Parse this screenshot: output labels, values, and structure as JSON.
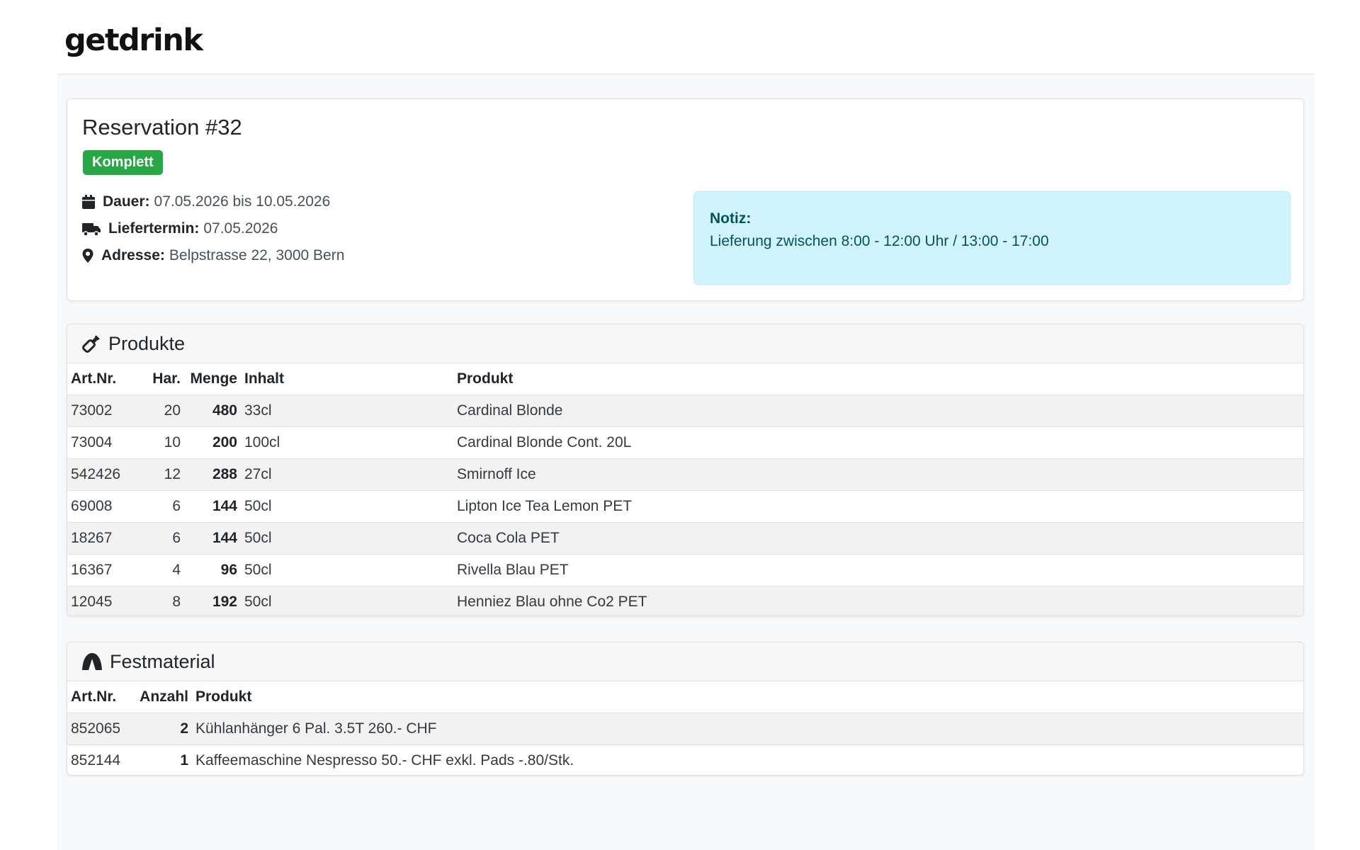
{
  "brand": {
    "logo_text": "getdrink"
  },
  "reservation": {
    "title": "Reservation #32",
    "status_badge": "Komplett",
    "status_color": "#28a745",
    "dauer_label": "Dauer:",
    "dauer_value": "07.05.2026 bis 10.05.2026",
    "liefertermin_label": "Liefertermin:",
    "liefertermin_value": "07.05.2026",
    "adresse_label": "Adresse:",
    "adresse_value": "Belpstrasse 22, 3000 Bern",
    "icons": {
      "dauer": "calendar-icon",
      "liefertermin": "truck-icon",
      "adresse": "map-marker-icon"
    }
  },
  "note": {
    "title": "Notiz:",
    "text": "Lieferung zwischen 8:00 - 12:00 Uhr / 13:00 - 17:00",
    "background_color": "#cff4fc"
  },
  "products": {
    "header": "Produkte",
    "icon": "bottle-icon",
    "columns": [
      "Art.Nr.",
      "Har.",
      "Menge",
      "Inhalt",
      "Produkt"
    ],
    "rows": [
      {
        "artnr": "73002",
        "har": "20",
        "menge": "480",
        "inhalt": "33cl",
        "produkt": "Cardinal Blonde"
      },
      {
        "artnr": "73004",
        "har": "10",
        "menge": "200",
        "inhalt": "100cl",
        "produkt": "Cardinal Blonde Cont. 20L"
      },
      {
        "artnr": "542426",
        "har": "12",
        "menge": "288",
        "inhalt": "27cl",
        "produkt": "Smirnoff Ice"
      },
      {
        "artnr": "69008",
        "har": "6",
        "menge": "144",
        "inhalt": "50cl",
        "produkt": "Lipton Ice Tea Lemon PET"
      },
      {
        "artnr": "18267",
        "har": "6",
        "menge": "144",
        "inhalt": "50cl",
        "produkt": "Coca Cola PET"
      },
      {
        "artnr": "16367",
        "har": "4",
        "menge": "96",
        "inhalt": "50cl",
        "produkt": "Rivella Blau PET"
      },
      {
        "artnr": "12045",
        "har": "8",
        "menge": "192",
        "inhalt": "50cl",
        "produkt": "Henniez Blau ohne Co2 PET"
      }
    ]
  },
  "festmaterial": {
    "header": "Festmaterial",
    "icon": "tent-icon",
    "columns": [
      "Art.Nr.",
      "Anzahl",
      "Produkt"
    ],
    "rows": [
      {
        "artnr": "852065",
        "anzahl": "2",
        "produkt": "Kühlanhänger 6 Pal. 3.5T 260.- CHF"
      },
      {
        "artnr": "852144",
        "anzahl": "1",
        "produkt": "Kaffeemaschine Nespresso 50.- CHF exkl. Pads -.80/Stk."
      }
    ]
  }
}
